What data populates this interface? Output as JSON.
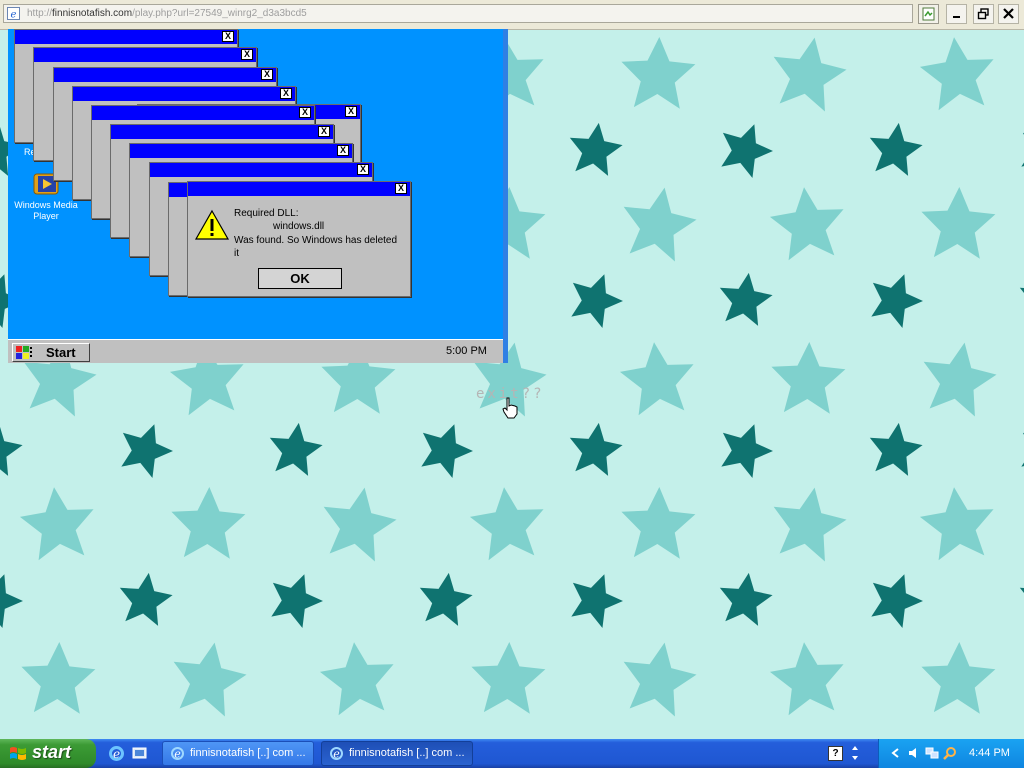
{
  "browser": {
    "address_prefix": "http://",
    "address_host": "finnisnotafish.com",
    "address_path": "/play.php?url=27549_winrg2_d3a3bcd5"
  },
  "scene": {
    "desktop_icons": [
      {
        "label": "Recycle",
        "icon": "recycle-bin-icon"
      },
      {
        "label": "Windows Media Player",
        "icon": "media-player-icon"
      }
    ],
    "dialog": {
      "close_glyph": "X",
      "line1": "Required DLL:",
      "line2": "windows.dll",
      "line3": "Was found. So Windows has deleted",
      "line4": "it",
      "ok_label": "OK"
    },
    "taskbar": {
      "start_label": "Start",
      "clock": "5:00 PM"
    },
    "exit_label": "exit??"
  },
  "xp_taskbar": {
    "start_label": "start",
    "tasks": [
      {
        "label": "finnisnotafish [..] com ...",
        "active": false
      },
      {
        "label": "finnisnotafish [..] com ...",
        "active": true
      }
    ],
    "clock": "4:44 PM",
    "help_glyph": "?"
  },
  "colors": {
    "wallpaper": "#c4f0ea",
    "star_light": "#7fd1cd",
    "star_dark": "#0f7370",
    "scene_bg": "#0092ff",
    "title_bar": "#0000ff",
    "xp_blue": "#245edb",
    "xp_green": "#3c9b35"
  }
}
